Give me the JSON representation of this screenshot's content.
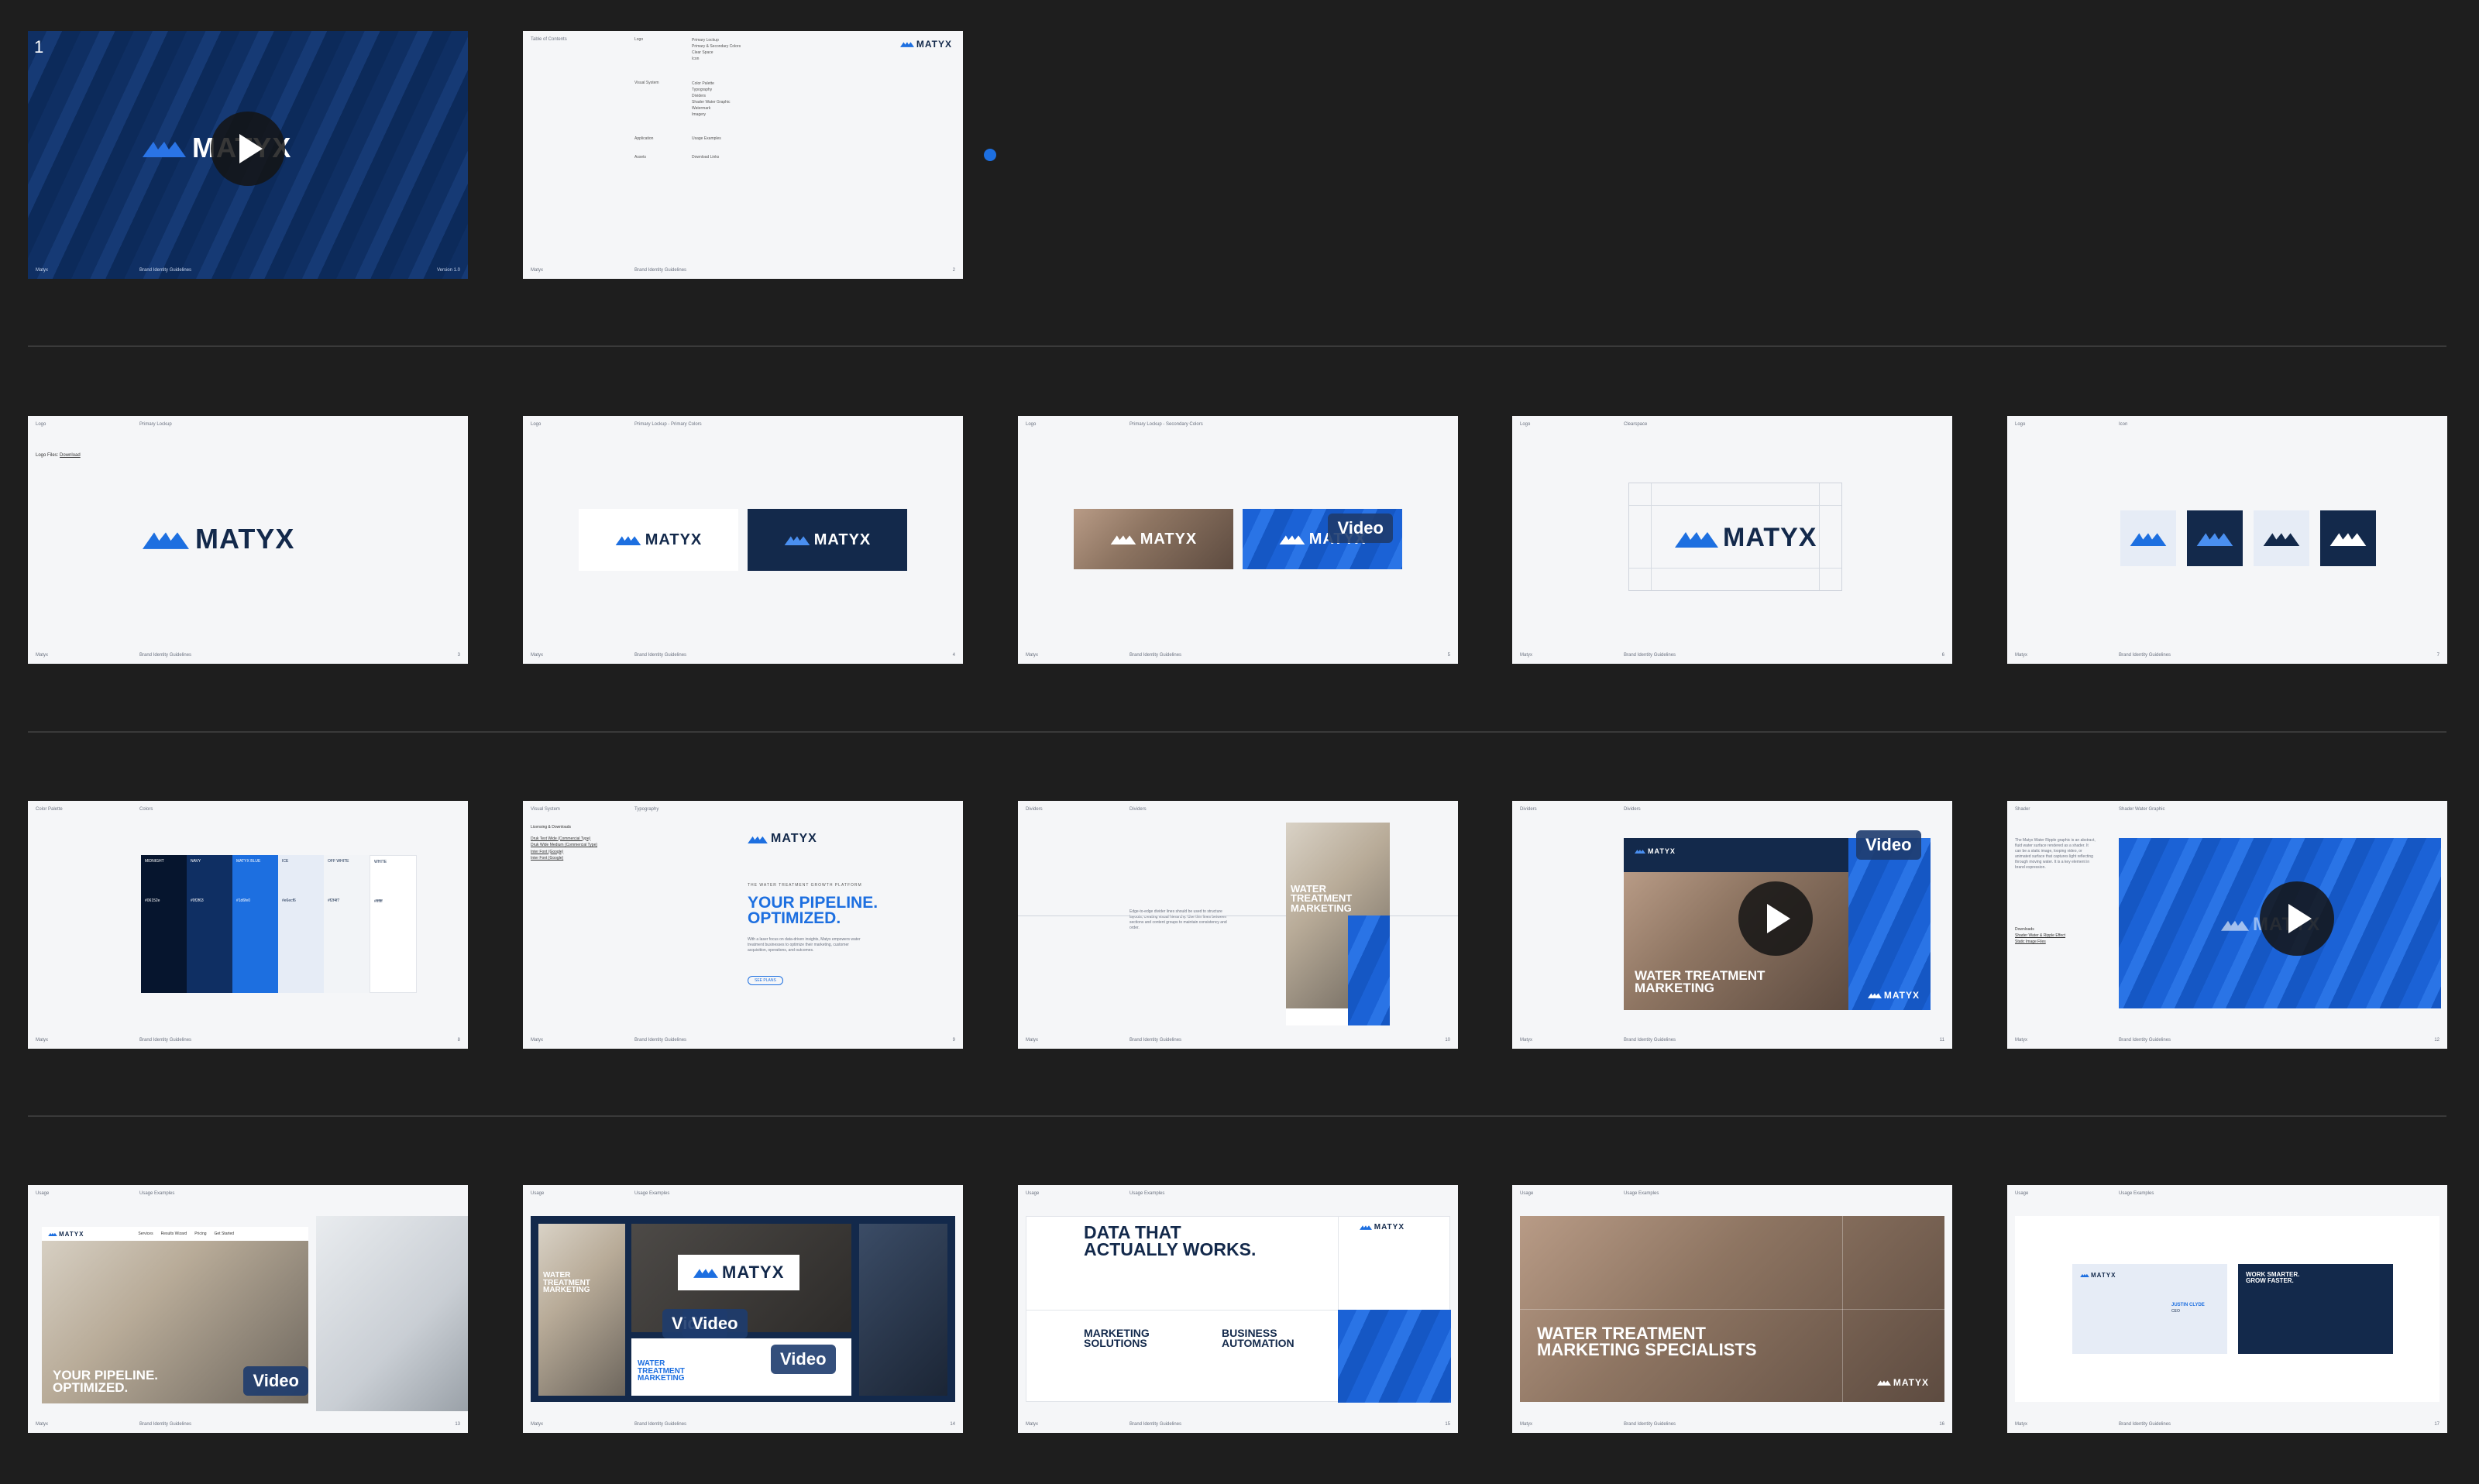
{
  "brand": "MATYX",
  "common": {
    "footer_brand": "Matyx",
    "footer_title": "Brand Identity Guidelines"
  },
  "colors": {
    "canvas": "#1e1e1e",
    "slide_bg": "#f5f6f8",
    "navy": "#13294b",
    "brand_blue": "#1d6fe0",
    "light_blue": "#4a8ff0"
  },
  "slides": {
    "s1": {
      "number": "1",
      "version": "Version 1.0"
    },
    "s2": {
      "head": "Table of Contents",
      "sections": [
        {
          "label": "Logo",
          "items": [
            "Primary Lockup",
            "Primary & Secondary Colors",
            "Clear Space",
            "Icon"
          ]
        },
        {
          "label": "Visual System",
          "items": [
            "Color Palette",
            "Typography",
            "Dividers",
            "Shader Water Graphic",
            "Watermark",
            "Imagery"
          ]
        },
        {
          "label": "Application",
          "items": [
            "Usage Examples"
          ]
        },
        {
          "label": "Assets",
          "items": [
            "Download Links"
          ]
        }
      ],
      "page": "2"
    },
    "s3": {
      "head": "Logo",
      "title": "Primary Lockup",
      "link_prefix": "Logo Files:",
      "link": "Download",
      "page": "3"
    },
    "s4": {
      "head": "Logo",
      "title": "Primary Lockup - Primary Colors",
      "page": "4"
    },
    "s5": {
      "head": "Logo",
      "title": "Primary Lockup - Secondary Colors",
      "video_label": "Video",
      "page": "5"
    },
    "s6": {
      "head": "Logo",
      "title": "Clearspace",
      "page": "6"
    },
    "s7": {
      "head": "Logo",
      "title": "Icon",
      "page": "7"
    },
    "s8": {
      "head": "Color Palette",
      "title": "Colors",
      "swatches": [
        {
          "name": "MIDNIGHT",
          "hex": "#06152e",
          "text": "#ffffff"
        },
        {
          "name": "NAVY",
          "hex": "#0f2f63",
          "text": "#ffffff"
        },
        {
          "name": "MATYX BLUE",
          "hex": "#1d6fe0",
          "text": "#ffffff"
        },
        {
          "name": "ICE",
          "hex": "#e6ecf6",
          "text": "#13294b"
        },
        {
          "name": "OFF WHITE",
          "hex": "#f2f4f7",
          "text": "#13294b"
        },
        {
          "name": "WHITE",
          "hex": "#ffffff",
          "text": "#13294b"
        }
      ],
      "page": "8"
    },
    "s9": {
      "head": "Visual System",
      "title": "Typography",
      "downloads_label": "Licensing & Downloads",
      "downloads": [
        "Druk Text Wide (Commercial Type)",
        "Druk Wide Medium (Commercial Type)",
        "Inter Font (Google)",
        "Inter Font (Google)"
      ],
      "eyebrow": "THE WATER TREATMENT GROWTH PLATFORM",
      "headline_1": "YOUR PIPELINE.",
      "headline_2": "OPTIMIZED.",
      "body": "With a laser focus on data-driven insights, Matyx empowers water treatment businesses to optimize their marketing, customer acquisition, operations, and outcomes.",
      "button": "SEE PLANS",
      "page": "9"
    },
    "s10": {
      "head": "Dividers",
      "title": "Dividers",
      "body": "Edge-to-edge divider lines should be used to structure layouts, creating visual hierarchy. Use thin lines between sections and content groups to maintain consistency and order.",
      "headline_1": "WATER",
      "headline_2": "TREATMENT",
      "headline_3": "MARKETING",
      "page": "10"
    },
    "s11": {
      "head": "Dividers",
      "title": "Dividers",
      "video_label": "Video",
      "headline_1": "WATER TREATMENT",
      "headline_2": "MARKETING",
      "page": "11"
    },
    "s12": {
      "head": "Shader",
      "title": "Shader Water Graphic",
      "body": "The Matyx Water Ripple graphic is an abstract, fluid water surface rendered as a shader. It can be a static image, looping video, or animated surface that captures light reflecting through moving water. It is a key element in brand expression.",
      "link_label": "Downloads",
      "links": [
        "Shader Water & Ripple Effect",
        "Static Image Files"
      ],
      "page": "12"
    },
    "s13": {
      "head": "Usage",
      "title": "Usage Examples",
      "nav": [
        "Services",
        "Results Wizard",
        "Pricing",
        "Get Started"
      ],
      "headline_1": "YOUR PIPELINE.",
      "headline_2": "OPTIMIZED.",
      "video_label": "Video",
      "page": "13"
    },
    "s14": {
      "head": "Usage",
      "title": "Usage Examples",
      "headline_1": "WATER",
      "headline_2": "TREATMENT",
      "headline_3": "MARKETING",
      "video_label_1": "Video",
      "video_label_2": "Video",
      "video_label_3": "Video",
      "page": "14"
    },
    "s15": {
      "head": "Usage",
      "title": "Usage Examples",
      "headline_1": "DATA THAT",
      "headline_2": "ACTUALLY WORKS.",
      "card1_title_1": "MARKETING",
      "card1_title_2": "SOLUTIONS",
      "card2_title_1": "BUSINESS",
      "card2_title_2": "AUTOMATION",
      "page": "15"
    },
    "s16": {
      "head": "Usage",
      "title": "Usage Examples",
      "headline_1": "WATER TREATMENT",
      "headline_2": "MARKETING SPECIALISTS",
      "page": "16"
    },
    "s17": {
      "head": "Usage",
      "title": "Usage Examples",
      "card_name": "JUSTIN CLYDE",
      "card_role": "CEO",
      "tagline_1": "WORK SMARTER.",
      "tagline_2": "GROW FASTER.",
      "page": "17"
    }
  }
}
